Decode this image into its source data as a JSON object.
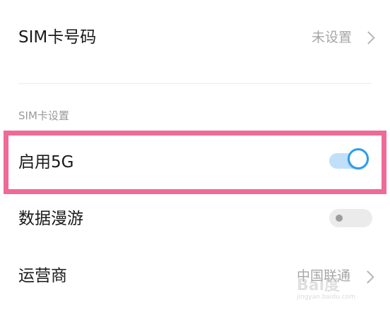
{
  "sim_number": {
    "label": "SIM卡号码",
    "value": "未设置",
    "chevron_icon": "chevron-right-icon"
  },
  "section": {
    "header": "SIM卡设置"
  },
  "enable_5g": {
    "label": "启用5G",
    "enabled": true,
    "highlight_color": "#ef6a96",
    "toggle_color": "#2b9cef"
  },
  "data_roaming": {
    "label": "数据漫游",
    "enabled": false
  },
  "carrier": {
    "label": "运营商",
    "value": "中国联通",
    "chevron_icon": "chevron-right-icon"
  },
  "watermark": {
    "text": "Bai度",
    "sub": "jingyan.baidu.com"
  }
}
